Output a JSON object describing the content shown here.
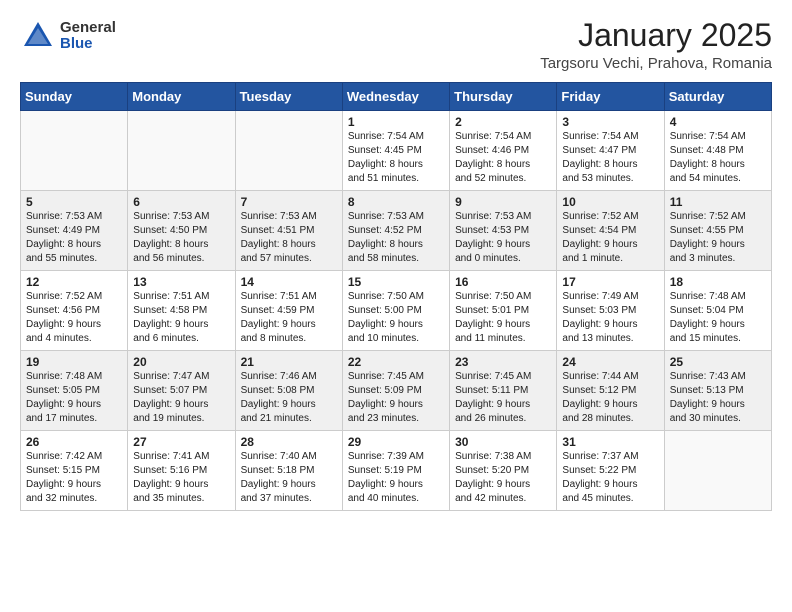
{
  "header": {
    "logo_general": "General",
    "logo_blue": "Blue",
    "month_title": "January 2025",
    "location": "Targsoru Vechi, Prahova, Romania"
  },
  "weekdays": [
    "Sunday",
    "Monday",
    "Tuesday",
    "Wednesday",
    "Thursday",
    "Friday",
    "Saturday"
  ],
  "weeks": [
    [
      {
        "day": "",
        "info": ""
      },
      {
        "day": "",
        "info": ""
      },
      {
        "day": "",
        "info": ""
      },
      {
        "day": "1",
        "info": "Sunrise: 7:54 AM\nSunset: 4:45 PM\nDaylight: 8 hours\nand 51 minutes."
      },
      {
        "day": "2",
        "info": "Sunrise: 7:54 AM\nSunset: 4:46 PM\nDaylight: 8 hours\nand 52 minutes."
      },
      {
        "day": "3",
        "info": "Sunrise: 7:54 AM\nSunset: 4:47 PM\nDaylight: 8 hours\nand 53 minutes."
      },
      {
        "day": "4",
        "info": "Sunrise: 7:54 AM\nSunset: 4:48 PM\nDaylight: 8 hours\nand 54 minutes."
      }
    ],
    [
      {
        "day": "5",
        "info": "Sunrise: 7:53 AM\nSunset: 4:49 PM\nDaylight: 8 hours\nand 55 minutes."
      },
      {
        "day": "6",
        "info": "Sunrise: 7:53 AM\nSunset: 4:50 PM\nDaylight: 8 hours\nand 56 minutes."
      },
      {
        "day": "7",
        "info": "Sunrise: 7:53 AM\nSunset: 4:51 PM\nDaylight: 8 hours\nand 57 minutes."
      },
      {
        "day": "8",
        "info": "Sunrise: 7:53 AM\nSunset: 4:52 PM\nDaylight: 8 hours\nand 58 minutes."
      },
      {
        "day": "9",
        "info": "Sunrise: 7:53 AM\nSunset: 4:53 PM\nDaylight: 9 hours\nand 0 minutes."
      },
      {
        "day": "10",
        "info": "Sunrise: 7:52 AM\nSunset: 4:54 PM\nDaylight: 9 hours\nand 1 minute."
      },
      {
        "day": "11",
        "info": "Sunrise: 7:52 AM\nSunset: 4:55 PM\nDaylight: 9 hours\nand 3 minutes."
      }
    ],
    [
      {
        "day": "12",
        "info": "Sunrise: 7:52 AM\nSunset: 4:56 PM\nDaylight: 9 hours\nand 4 minutes."
      },
      {
        "day": "13",
        "info": "Sunrise: 7:51 AM\nSunset: 4:58 PM\nDaylight: 9 hours\nand 6 minutes."
      },
      {
        "day": "14",
        "info": "Sunrise: 7:51 AM\nSunset: 4:59 PM\nDaylight: 9 hours\nand 8 minutes."
      },
      {
        "day": "15",
        "info": "Sunrise: 7:50 AM\nSunset: 5:00 PM\nDaylight: 9 hours\nand 10 minutes."
      },
      {
        "day": "16",
        "info": "Sunrise: 7:50 AM\nSunset: 5:01 PM\nDaylight: 9 hours\nand 11 minutes."
      },
      {
        "day": "17",
        "info": "Sunrise: 7:49 AM\nSunset: 5:03 PM\nDaylight: 9 hours\nand 13 minutes."
      },
      {
        "day": "18",
        "info": "Sunrise: 7:48 AM\nSunset: 5:04 PM\nDaylight: 9 hours\nand 15 minutes."
      }
    ],
    [
      {
        "day": "19",
        "info": "Sunrise: 7:48 AM\nSunset: 5:05 PM\nDaylight: 9 hours\nand 17 minutes."
      },
      {
        "day": "20",
        "info": "Sunrise: 7:47 AM\nSunset: 5:07 PM\nDaylight: 9 hours\nand 19 minutes."
      },
      {
        "day": "21",
        "info": "Sunrise: 7:46 AM\nSunset: 5:08 PM\nDaylight: 9 hours\nand 21 minutes."
      },
      {
        "day": "22",
        "info": "Sunrise: 7:45 AM\nSunset: 5:09 PM\nDaylight: 9 hours\nand 23 minutes."
      },
      {
        "day": "23",
        "info": "Sunrise: 7:45 AM\nSunset: 5:11 PM\nDaylight: 9 hours\nand 26 minutes."
      },
      {
        "day": "24",
        "info": "Sunrise: 7:44 AM\nSunset: 5:12 PM\nDaylight: 9 hours\nand 28 minutes."
      },
      {
        "day": "25",
        "info": "Sunrise: 7:43 AM\nSunset: 5:13 PM\nDaylight: 9 hours\nand 30 minutes."
      }
    ],
    [
      {
        "day": "26",
        "info": "Sunrise: 7:42 AM\nSunset: 5:15 PM\nDaylight: 9 hours\nand 32 minutes."
      },
      {
        "day": "27",
        "info": "Sunrise: 7:41 AM\nSunset: 5:16 PM\nDaylight: 9 hours\nand 35 minutes."
      },
      {
        "day": "28",
        "info": "Sunrise: 7:40 AM\nSunset: 5:18 PM\nDaylight: 9 hours\nand 37 minutes."
      },
      {
        "day": "29",
        "info": "Sunrise: 7:39 AM\nSunset: 5:19 PM\nDaylight: 9 hours\nand 40 minutes."
      },
      {
        "day": "30",
        "info": "Sunrise: 7:38 AM\nSunset: 5:20 PM\nDaylight: 9 hours\nand 42 minutes."
      },
      {
        "day": "31",
        "info": "Sunrise: 7:37 AM\nSunset: 5:22 PM\nDaylight: 9 hours\nand 45 minutes."
      },
      {
        "day": "",
        "info": ""
      }
    ]
  ]
}
